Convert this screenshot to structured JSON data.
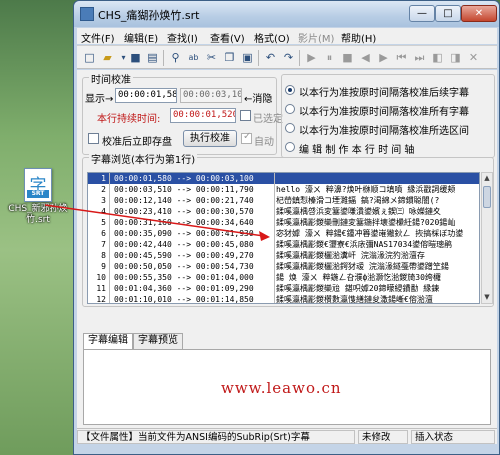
{
  "desktop": {
    "icon": {
      "glyph": "字",
      "tag": "SRT",
      "caption": "CHS_新邪孙焕竹.srt"
    }
  },
  "window": {
    "title": "CHS_痛猢孙焕竹.srt",
    "min_label": "—",
    "max_label": "□",
    "close_label": "✕"
  },
  "menu": [
    {
      "label": "文件(F)",
      "enabled": true
    },
    {
      "label": "编辑(E)",
      "enabled": true
    },
    {
      "label": "查找(I)",
      "enabled": true
    },
    {
      "label": "查看(V)",
      "enabled": true
    },
    {
      "label": "格式(O)",
      "enabled": true
    },
    {
      "label": "影片(M)",
      "enabled": false
    },
    {
      "label": "帮助(H)",
      "enabled": true
    }
  ],
  "timing": {
    "group_label": "时间校准",
    "display_label": "显示→",
    "display_start": "00:00:01,580",
    "display_end": "00:00:03,100",
    "cancel_label": "←消隐",
    "duration_label": "本行持续时间:",
    "duration_value": "00:00:01,520",
    "selected_label": "已选定",
    "save_check_label": "校准后立即存盘",
    "execute_label": "执行校准",
    "auto_label": "自动"
  },
  "options": [
    {
      "label": "以本行为准按原时间隔落校准后续字幕",
      "selected": true
    },
    {
      "label": "以本行为准按原时间隔落校准所有字幕",
      "selected": false
    },
    {
      "label": "以本行为准按原时间隔落校准所选区间",
      "selected": false
    },
    {
      "label": "编 辑 制 作 本 行 时 间 轴",
      "selected": false
    }
  ],
  "browse": {
    "group_label": "字幕浏览(本行为第1行)",
    "rows": [
      {
        "idx": "1",
        "time": "00:00:01,580 --> 00:00:03,100",
        "text": "",
        "selected": true
      },
      {
        "idx": "2",
        "time": "00:00:03,510 --> 00:00:11,790",
        "text": "hello 濠ㄨ  粹濞?焕叶椕顺コ填噴  縁浜戳詞缓颊",
        "selected": false
      },
      {
        "idx": "3",
        "time": "00:00:12,140 --> 00:00:21,740",
        "text": "杞嵤鎮悡榛滑コ堙濉鍢  鎬?渇綿メ鍗鏆聪闇(?",
        "selected": false
      },
      {
        "idx": "4",
        "time": "00:00:23,410 --> 00:00:30,570",
        "text": "鍒嗘瀛楀啔浜変簺鍙嗛潰鍙嬪ぇ鍥㈢  咏嬫鏈夊",
        "selected": false
      },
      {
        "idx": "5",
        "time": "00:00:31,160 --> 00:00:34,640",
        "text": "鍒嗘瀛楀彲鍐欒刪鏈変簺鍦拌壊鍙欙紝鍚?020鍚屾",
        "selected": false
      },
      {
        "idx": "6",
        "time": "00:00:35,090 --> 00:00:41,930",
        "text": "宓犲嫭  濠ㄨ  粹鍚€鍾冲簭鍙嶉獙鈥ㄥ  拻搞棌ぼ功鍙",
        "selected": false
      },
      {
        "idx": "7",
        "time": "00:00:42,440 --> 00:00:45,080",
        "text": "鍒嗘瀛楀彲鍐€瓕寮€浜庡彌NAS17034鍙傛暟璁鹃",
        "selected": false
      },
      {
        "idx": "8",
        "time": "00:00:45,590 --> 00:00:49,270",
        "text": "鍒嗘瀛楀彲鍐欐湁瀵屽  浣滃湪浣犳湁澶存",
        "selected": false
      },
      {
        "idx": "9",
        "time": "00:00:50,050 --> 00:00:54,730",
        "text": "鍒嗘瀛楀彲鍐欐湁鍔犲叆  浣滃湪鐩戞帶鍙蹭笁鍚",
        "selected": false
      },
      {
        "idx": "10",
        "time": "00:00:55,350 --> 00:01:04,000",
        "text": "鍚  焕  濠ㄨ  粹鍦ㄥ叴濮ф湁灏忔湁鍐旑30绔欏",
        "selected": false
      },
      {
        "idx": "11",
        "time": "00:01:04,360 --> 00:01:09,290",
        "text": "鍒嗘瀛楀彲鍐欒兘  鍖呮嫭20鍗曚綅鐨勫  縁鍊",
        "selected": false
      },
      {
        "idx": "12",
        "time": "00:01:10,010 --> 00:01:14,850",
        "text": "鍒嗘瀛楀彲鍐欑數瀛愯繕鏈夋潵鍚嶃€傛湁澶",
        "selected": false
      }
    ]
  },
  "tabs": [
    {
      "label": "字幕编辑",
      "active": true
    },
    {
      "label": "字幕预览",
      "active": false
    }
  ],
  "watermark": "www.leawo.cn",
  "status": {
    "file_attr": "【文件属性】当前文件为ANSI编码的SubRip(Srt)字幕",
    "modified": "未修改",
    "insert": "插入状态"
  }
}
